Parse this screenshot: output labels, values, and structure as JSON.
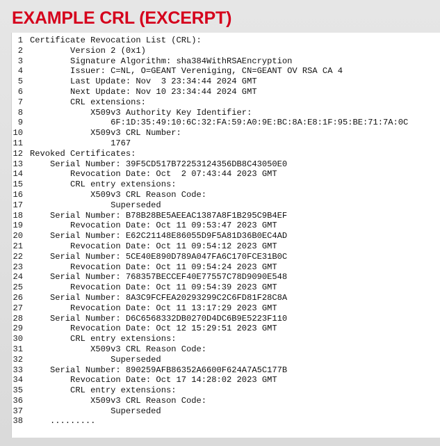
{
  "title": "EXAMPLE CRL (EXCERPT)",
  "lines": [
    "Certificate Revocation List (CRL):",
    "        Version 2 (0x1)",
    "        Signature Algorithm: sha384WithRSAEncryption",
    "        Issuer: C=NL, O=GEANT Vereniging, CN=GEANT OV RSA CA 4",
    "        Last Update: Nov  3 23:34:44 2024 GMT",
    "        Next Update: Nov 10 23:34:44 2024 GMT",
    "        CRL extensions:",
    "            X509v3 Authority Key Identifier:",
    "                6F:1D:35:49:10:6C:32:FA:59:A0:9E:BC:8A:E8:1F:95:BE:71:7A:0C",
    "            X509v3 CRL Number:",
    "                1767",
    "Revoked Certificates:",
    "    Serial Number: 39F5CD517B72253124356DB8C43050E0",
    "        Revocation Date: Oct  2 07:43:44 2023 GMT",
    "        CRL entry extensions:",
    "            X509v3 CRL Reason Code:",
    "                Superseded",
    "    Serial Number: B78B28BE5AEEAC1387A8F1B295C9B4EF",
    "        Revocation Date: Oct 11 09:53:47 2023 GMT",
    "    Serial Number: E62C21148E86055D9F5A81D36B0EC4AD",
    "        Revocation Date: Oct 11 09:54:12 2023 GMT",
    "    Serial Number: 5CE40E890D789A047FA6C170FCE31B0C",
    "        Revocation Date: Oct 11 09:54:24 2023 GMT",
    "    Serial Number: 768357BECCEF40E77557C78D9090E548",
    "        Revocation Date: Oct 11 09:54:39 2023 GMT",
    "    Serial Number: 8A3C9FCFEA20293299C2C6FD81F28C8A",
    "        Revocation Date: Oct 11 13:17:29 2023 GMT",
    "    Serial Number: D6C6568332DB0270D4DC6B9E5223F110",
    "        Revocation Date: Oct 12 15:29:51 2023 GMT",
    "        CRL entry extensions:",
    "            X509v3 CRL Reason Code:",
    "                Superseded",
    "    Serial Number: 890259AFB86352A6600F624A7A5C177B",
    "        Revocation Date: Oct 17 14:28:02 2023 GMT",
    "        CRL entry extensions:",
    "            X509v3 CRL Reason Code:",
    "                Superseded",
    "    ........."
  ],
  "colors": {
    "title": "#d5001c",
    "background": "#dedede",
    "panel": "#ffffff",
    "text": "#111111"
  }
}
